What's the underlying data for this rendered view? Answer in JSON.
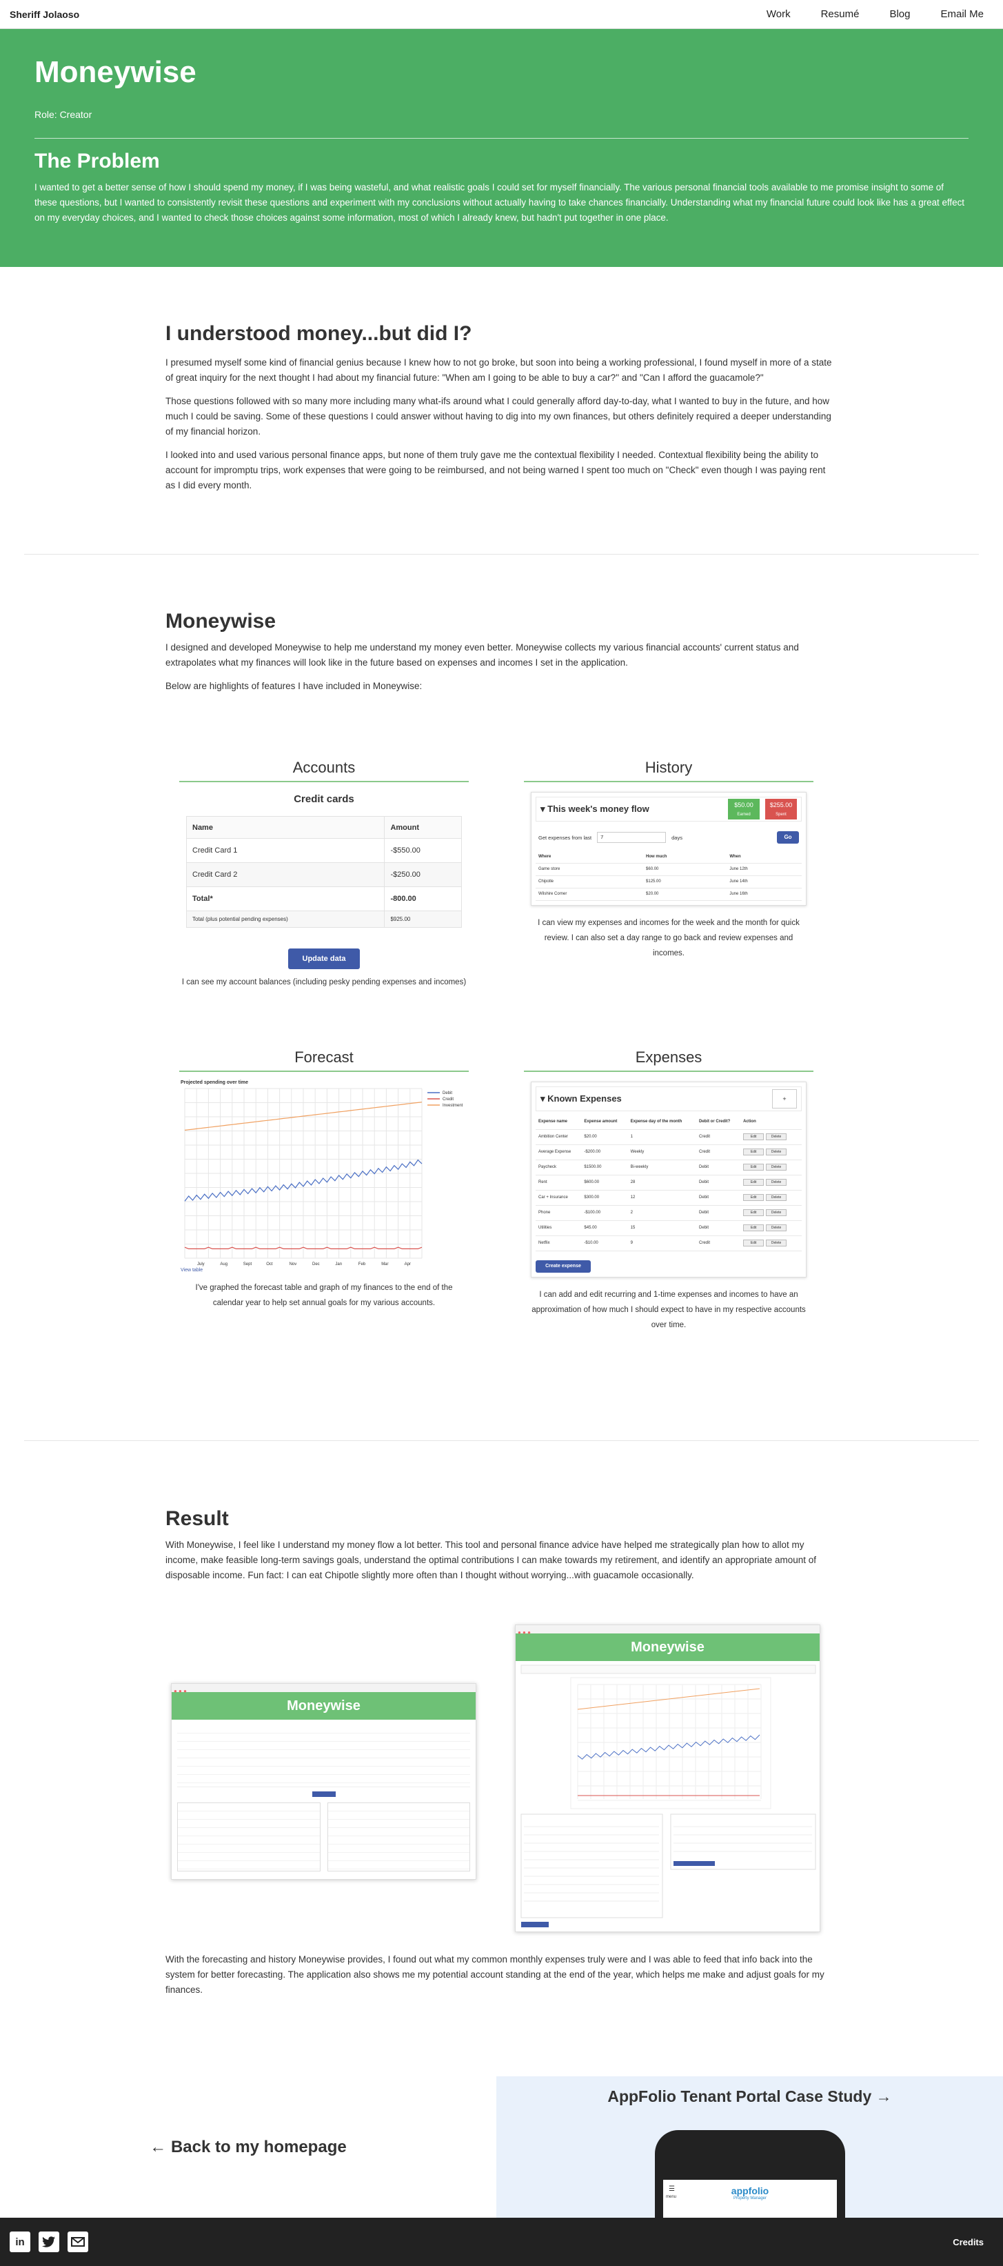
{
  "nav": {
    "brand": "Sheriff Jolaoso",
    "links": [
      "Work",
      "Resumé",
      "Blog",
      "Email Me"
    ]
  },
  "hero": {
    "title": "Moneywise",
    "role": "Role: Creator",
    "problem_heading": "The Problem",
    "problem_text": "I wanted to get a better sense of how I should spend my money, if I was being wasteful, and what realistic goals I could set for myself financially. The various personal financial tools available to me promise insight to some of these questions, but I wanted to consistently revisit these questions and experiment with my conclusions without actually having to take chances financially. Understanding what my financial future could look like has a great effect on my everyday choices, and I wanted to check those choices against some information, most of which I already knew, but hadn't put together in one place."
  },
  "understood": {
    "heading": "I understood money...but did I?",
    "p1": "I presumed myself some kind of financial genius because I knew how to not go broke, but soon into being a working professional, I found myself in more of a state of great inquiry for the next thought I had about my financial future: \"When am I going to be able to buy a car?\" and \"Can I afford the guacamole?\"",
    "p2": "Those questions followed with so many more including many what-ifs around what I could generally afford day-to-day, what I wanted to buy in the future, and how much I could be saving. Some of these questions I could answer without having to dig into my own finances, but others definitely required a deeper understanding of my financial horizon.",
    "p3": "I looked into and used various personal finance apps, but none of them truly gave me the contextual flexibility I needed. Contextual flexibility being the ability to account for impromptu trips, work expenses that were going to be reimbursed, and not being warned I spent too much on \"Check\" even though I was paying rent as I did every month."
  },
  "moneywise": {
    "heading": "Moneywise",
    "p1": "I designed and developed Moneywise to help me understand my money even better. Moneywise collects my various financial accounts' current status and extrapolates what my finances will look like in the future based on expenses and incomes I set in the application.",
    "p2": "Below are highlights of features I have included in Moneywise:"
  },
  "accounts": {
    "title": "Accounts",
    "subtitle": "Credit cards",
    "columns": [
      "Name",
      "Amount"
    ],
    "rows": [
      [
        "Credit Card 1",
        "-$550.00"
      ],
      [
        "Credit Card 2",
        "-$250.00"
      ]
    ],
    "total_label": "Total*",
    "total_value": "-800.00",
    "note_label": "Total (plus potential pending expenses)",
    "note_value": "$925.00",
    "button": "Update data",
    "caption": "I can see my account balances (including pesky pending expenses and incomes)"
  },
  "history": {
    "title": "History",
    "panel_title": "This week's money flow",
    "badge_green": "$50.00",
    "badge_green_sub": "Earned",
    "badge_red": "$255.00",
    "badge_red_sub": "Spent",
    "filter_label": "Get expenses from last",
    "filter_value": "7",
    "filter_unit": "days",
    "go": "Go",
    "columns": [
      "Where",
      "How much",
      "When"
    ],
    "rows": [
      [
        "Game store",
        "$60.00",
        "June 12th"
      ],
      [
        "Chipotle",
        "$125.00",
        "June 14th"
      ],
      [
        "Wilshire Corner",
        "$20.00",
        "June 16th"
      ]
    ],
    "caption": "I can view my expenses and incomes for the week and the month for quick review. I can also set a day range to go back and review expenses and incomes."
  },
  "forecast": {
    "title": "Forecast",
    "chart_title": "Projected spending over time",
    "legend": [
      "Debit",
      "Credit",
      "Investment"
    ],
    "months": [
      "July",
      "Aug",
      "Sept",
      "Oct",
      "Nov",
      "Dec",
      "Jan",
      "Feb",
      "Mar",
      "Apr"
    ],
    "view_table": "View table",
    "caption": "I've graphed the forecast table and graph of my finances to the end of the calendar year to help set annual goals for my various accounts.",
    "colors": {
      "debit": "#4a6fc4",
      "credit": "#d9534f",
      "investment": "#f0a060"
    }
  },
  "chart_data": {
    "type": "line",
    "title": "Projected spending over time",
    "x": [
      "July",
      "Aug",
      "Sept",
      "Oct",
      "Nov",
      "Dec",
      "Jan",
      "Feb",
      "Mar",
      "Apr"
    ],
    "series": [
      {
        "name": "Debit",
        "values": [
          0.38,
          0.4,
          0.42,
          0.44,
          0.46,
          0.49,
          0.52,
          0.55,
          0.58,
          0.62
        ]
      },
      {
        "name": "Credit",
        "values": [
          0.06,
          0.06,
          0.06,
          0.06,
          0.06,
          0.06,
          0.06,
          0.06,
          0.06,
          0.06
        ]
      },
      {
        "name": "Investment",
        "values": [
          0.82,
          0.84,
          0.86,
          0.88,
          0.9,
          0.92,
          0.94,
          0.96,
          0.98,
          1.0
        ]
      }
    ]
  },
  "expenses": {
    "title": "Expenses",
    "panel_title": "Known Expenses",
    "add_small": "+",
    "columns": [
      "Expense name",
      "Expense amount",
      "Expense day of the month",
      "Debit or Credit?",
      "Action"
    ],
    "rows": [
      [
        "Ambition Center",
        "$20.00",
        "1",
        "Credit"
      ],
      [
        "Average Expense",
        "-$200.00",
        "Weekly",
        "Credit"
      ],
      [
        "Paycheck",
        "$1500.00",
        "Bi-weekly",
        "Debit"
      ],
      [
        "Rent",
        "$600.00",
        "28",
        "Debit"
      ],
      [
        "Car + Insurance",
        "$300.00",
        "12",
        "Debit"
      ],
      [
        "Phone",
        "-$100.00",
        "2",
        "Debit"
      ],
      [
        "Utilities",
        "$45.00",
        "15",
        "Debit"
      ],
      [
        "Netflix",
        "-$10.00",
        "9",
        "Credit"
      ]
    ],
    "edit": "Edit",
    "delete": "Delete",
    "button": "Create expense",
    "caption": "I can add and edit recurring and 1-time expenses and incomes to have an approximation of how much I should expect to have in my respective accounts over time."
  },
  "result": {
    "heading": "Result",
    "p1": "With Moneywise, I feel like I understand my money flow a lot better. This tool and personal finance advice have helped me strategically plan how to allot my income, make feasible long-term savings goals, understand the optimal contributions I can make towards my retirement, and identify an appropriate amount of disposable income. Fun fact: I can eat Chipotle slightly more often than I thought without worrying...with guacamole occasionally.",
    "p2": "With the forecasting and history Moneywise provides, I found out what my common monthly expenses truly were and I was able to feed that info back into the system for better forecasting. The application also shows me my potential account standing at the end of the year, which helps me make and adjust goals for my finances.",
    "shot_title": "Moneywise"
  },
  "bottom": {
    "back": "Back to my homepage",
    "next": "AppFolio Tenant Portal Case Study",
    "phone_logo": "appfolio",
    "phone_sub": "Property Manager",
    "menu": "menu"
  },
  "footer": {
    "credits": "Credits",
    "social": [
      "linkedin-icon",
      "twitter-icon",
      "email-icon"
    ]
  }
}
